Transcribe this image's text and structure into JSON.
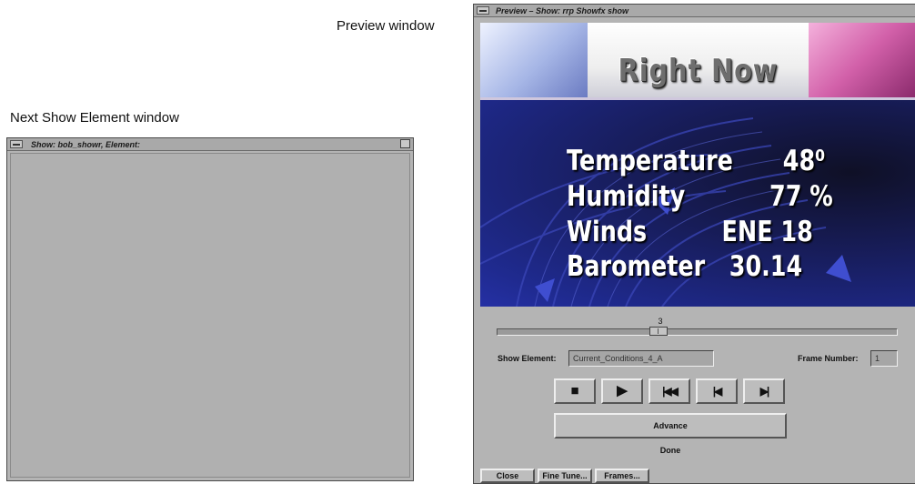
{
  "captions": {
    "preview": "Preview window",
    "next": "Next Show Element window"
  },
  "next_window": {
    "title": "Show: bob_showr, Element:"
  },
  "preview_window": {
    "title": "Preview – Show: rrp Showfx show",
    "banner_title": "Right Now",
    "weather": [
      {
        "label": "Temperature",
        "value": "48⁰"
      },
      {
        "label": "Humidity",
        "value": "77 %"
      },
      {
        "label": "Winds",
        "value": "ENE  18"
      },
      {
        "label": "Barometer",
        "value": "30.14"
      }
    ],
    "slider": {
      "value": "3"
    },
    "show_element_label": "Show Element:",
    "show_element_value": "Current_Conditions_4_A",
    "frame_number_label": "Frame Number:",
    "frame_number_value": "1",
    "transport": {
      "stop": "■",
      "play": "▶",
      "rewind": "|◀◀",
      "step_back": "|◀",
      "step_forward": "▶|"
    },
    "advance_label": "Advance",
    "status": "Done",
    "buttons": {
      "close": "Close",
      "fine_tune": "Fine Tune...",
      "frames": "Frames..."
    }
  },
  "colors": {
    "window_bg": "#b4b4b4",
    "stage_blue": "#1f2a8f",
    "tile_pink": "#d260a9",
    "tile_blue": "#a6b6e6"
  }
}
